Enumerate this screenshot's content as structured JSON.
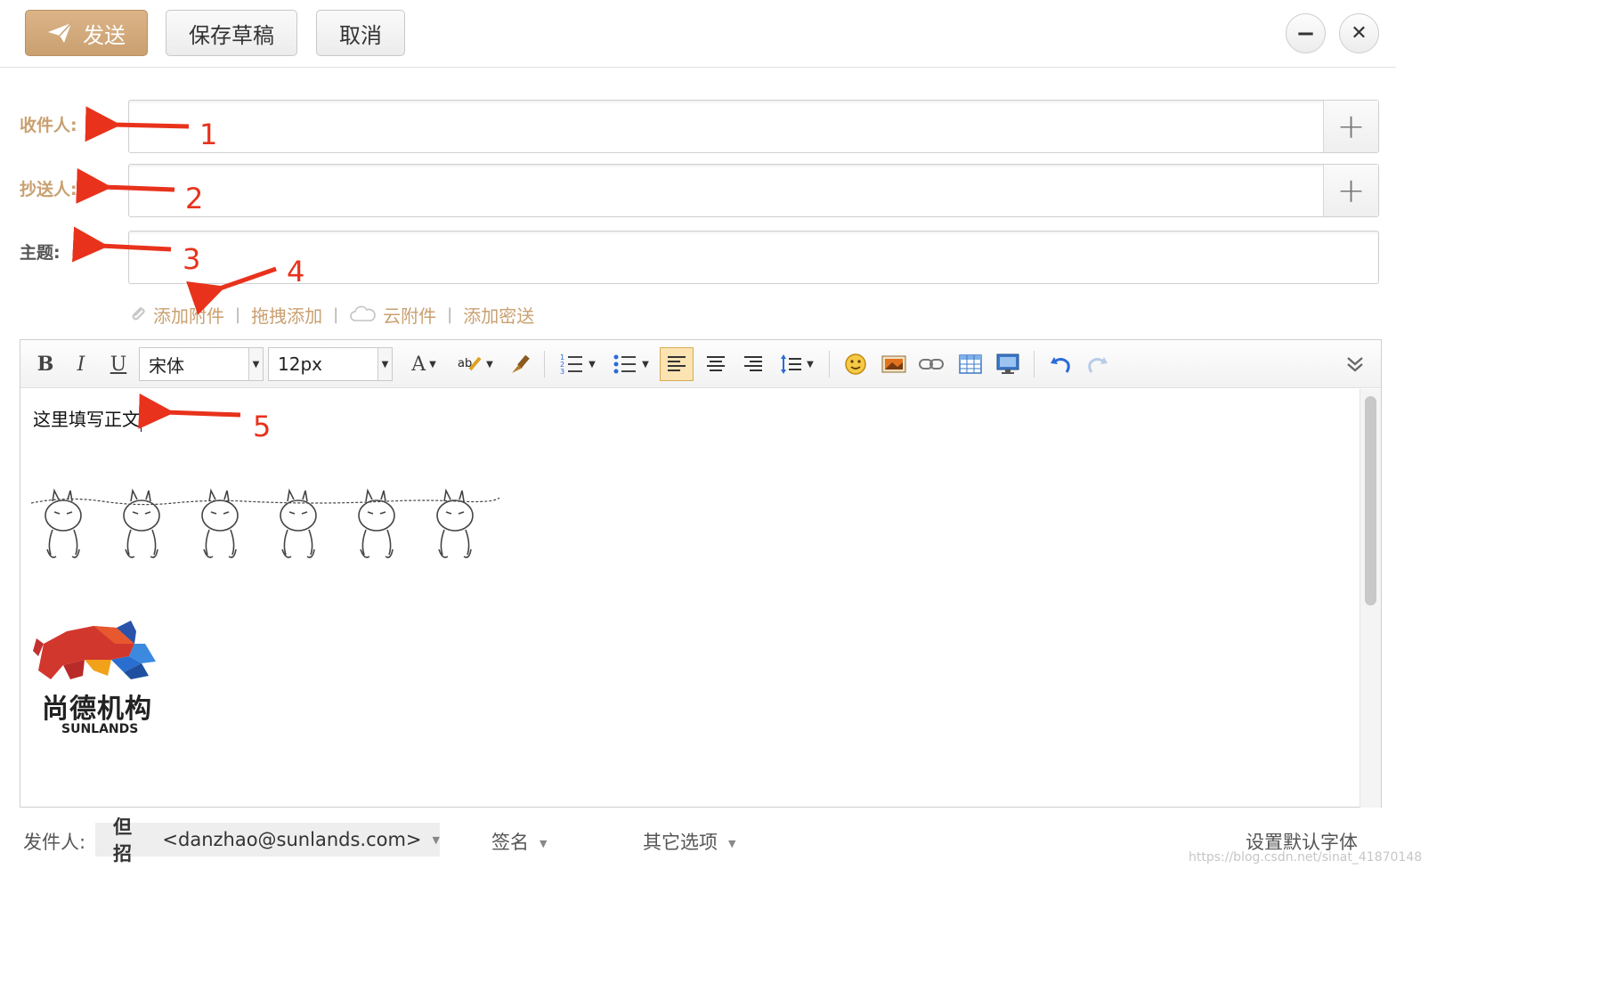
{
  "toolbar": {
    "send_label": "发送",
    "save_draft_label": "保存草稿",
    "cancel_label": "取消",
    "minimize_symbol": "−",
    "close_symbol": "✕"
  },
  "form": {
    "to_label": "收件人:",
    "cc_label": "抄送人:",
    "subject_label": "主题:",
    "add_symbol": "+",
    "attach": {
      "add_attachment": "添加附件",
      "drag_add": "拖拽添加",
      "cloud_attachment": "云附件",
      "add_bcc": "添加密送",
      "separator": "|"
    }
  },
  "editor": {
    "bold": "B",
    "italic": "I",
    "underline": "U",
    "font_family": "宋体",
    "font_size": "12px",
    "font_color": "A",
    "body_text": "这里填写正文",
    "icons": [
      "bold-icon",
      "italic-icon",
      "underline-icon",
      "font-color-icon",
      "highlight-icon",
      "format-brush-icon",
      "ordered-list-icon",
      "unordered-list-icon",
      "align-left-icon",
      "align-center-icon",
      "align-right-icon",
      "line-height-icon",
      "emoji-icon",
      "image-icon",
      "link-icon",
      "table-icon",
      "screenshot-icon",
      "undo-icon",
      "redo-icon",
      "expand-icon"
    ],
    "logo_cn": "尚德机构",
    "logo_en": "SUNLANDS"
  },
  "footer": {
    "sender_label": "发件人:",
    "sender_name": "但招",
    "sender_email": "<danzhao@sunlands.com>",
    "signature": "签名",
    "other_options": "其它选项",
    "default_font": "设置默认字体"
  },
  "annotations": [
    "1",
    "2",
    "3",
    "4",
    "5"
  ],
  "watermark": "https://blog.csdn.net/sinat_41870148",
  "colors": {
    "accent": "#c9a070",
    "annotation": "#e8321c"
  }
}
